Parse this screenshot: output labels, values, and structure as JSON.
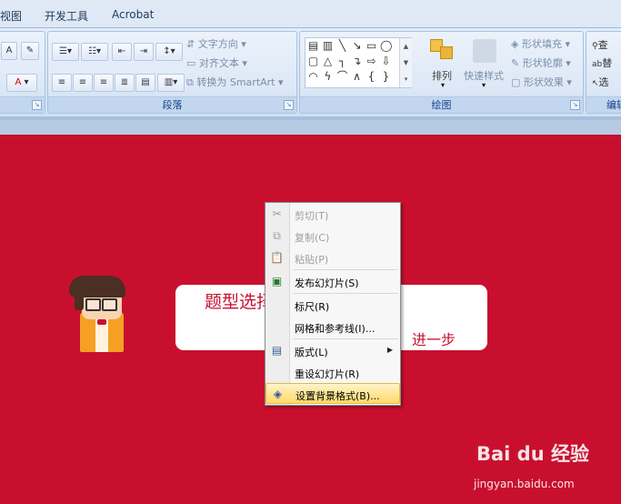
{
  "tabs": [
    "视图",
    "开发工具",
    "Acrobat"
  ],
  "ribbon": {
    "font_group": {
      "btn_grow": "A",
      "btn_color": "A"
    },
    "paragraph_group": {
      "label": "段落",
      "text_direction": "文字方向",
      "align_text": "对齐文本",
      "convert_smartart": "转换为 SmartArt"
    },
    "drawing_group": {
      "label": "绘图",
      "arrange": "排列",
      "quick_styles": "快速样式",
      "shape_fill": "形状填充",
      "shape_outline": "形状轮廓",
      "shape_effects": "形状效果"
    },
    "editing_group": {
      "label": "编辑",
      "find": "查",
      "replace": "替",
      "select": "选"
    }
  },
  "slide": {
    "card_text_left": "题型选择",
    "card_text_right": "进一步"
  },
  "context_menu": {
    "items": [
      {
        "label": "剪切(T)",
        "icon": "scissors-icon",
        "disabled": true
      },
      {
        "label": "复制(C)",
        "icon": "copy-icon",
        "disabled": true
      },
      {
        "label": "粘贴(P)",
        "icon": "paste-icon",
        "disabled": true
      },
      {
        "label": "发布幻灯片(S)",
        "icon": "publish-icon",
        "disabled": false
      },
      {
        "label": "标尺(R)",
        "icon": "",
        "disabled": false
      },
      {
        "label": "网格和参考线(I)...",
        "icon": "",
        "disabled": false
      },
      {
        "label": "版式(L)",
        "icon": "layout-icon",
        "disabled": false,
        "submenu": true
      },
      {
        "label": "重设幻灯片(R)",
        "icon": "",
        "disabled": false
      },
      {
        "label": "设置背景格式(B)...",
        "icon": "background-format-icon",
        "disabled": false,
        "highlighted": true
      }
    ]
  },
  "watermark": {
    "logo": "Bai du 经验",
    "url": "jingyan.baidu.com"
  }
}
